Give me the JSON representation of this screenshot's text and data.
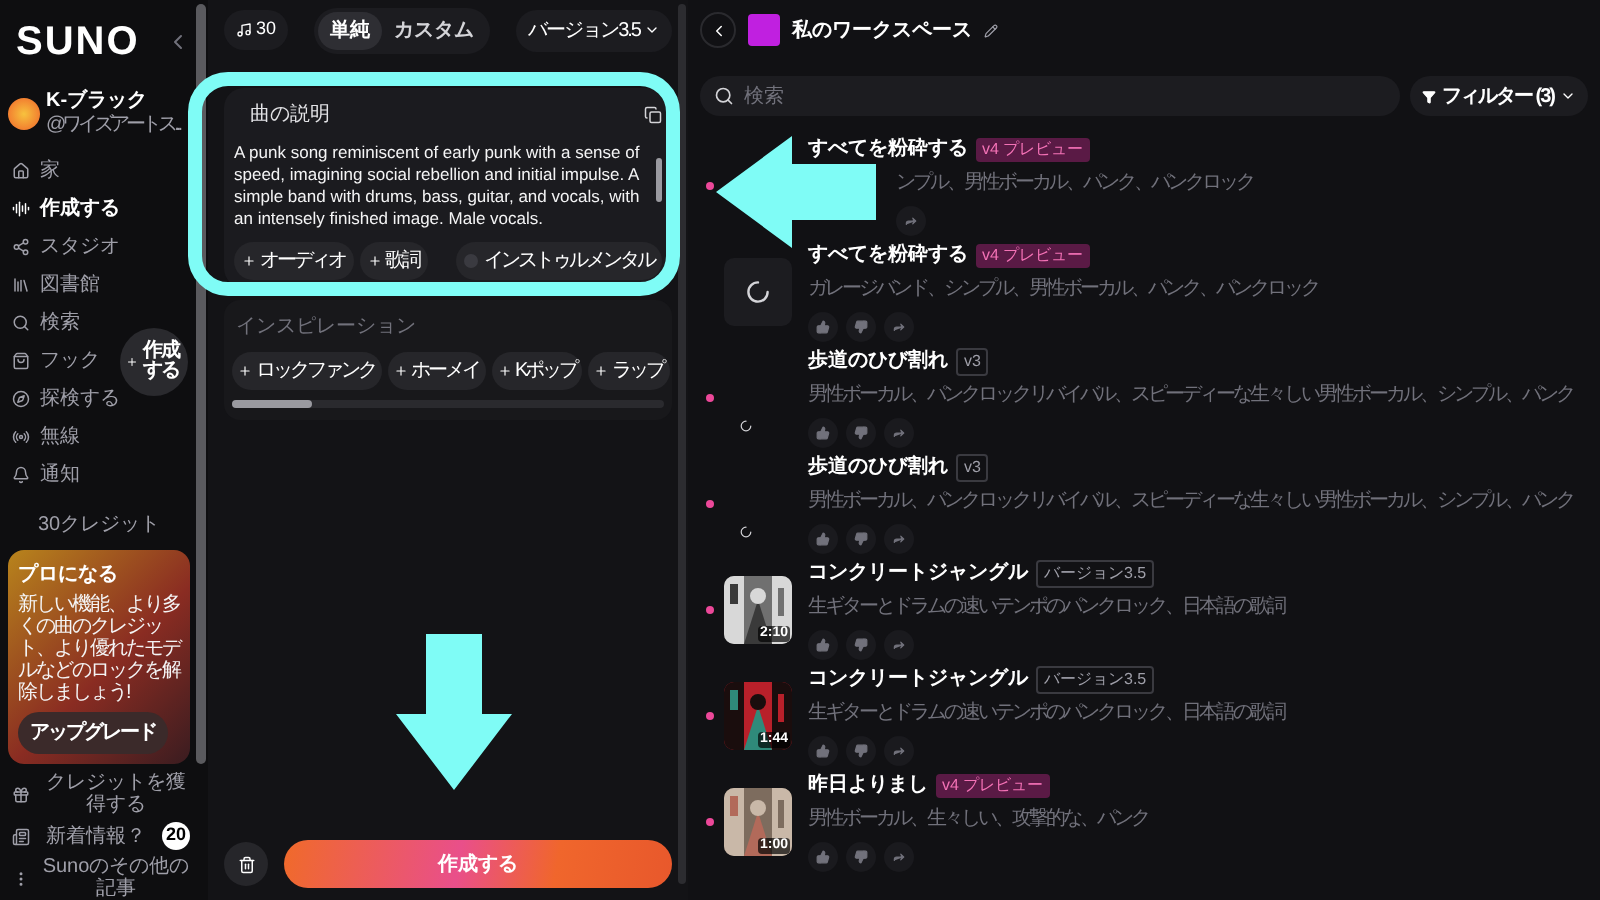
{
  "sidebar": {
    "logo": "SUNO",
    "user": {
      "name": "K-ブラック",
      "handle": "@ワイズアートス..."
    },
    "nav": [
      {
        "label": "家",
        "selected": false
      },
      {
        "label": "作成する",
        "selected": true
      },
      {
        "label": "スタジオ",
        "selected": false
      },
      {
        "label": "図書館",
        "selected": false
      },
      {
        "label": "検索",
        "selected": false
      },
      {
        "label": "フック",
        "selected": false
      },
      {
        "label": "探検する",
        "selected": false
      },
      {
        "label": "無線",
        "selected": false
      },
      {
        "label": "通知",
        "selected": false
      }
    ],
    "create_fab": "作成する",
    "credits": "30クレジット",
    "promo": {
      "title": "プロになる",
      "text": "新しい機能、より多くの曲のクレジット、より優れたモデルなどのロックを解除しましょう!",
      "button": "アップグレード"
    },
    "footer": [
      {
        "label": "クレジットを獲得する"
      },
      {
        "label": "新着情報？",
        "badge": "20"
      },
      {
        "label": "Sunoのその他の記事"
      }
    ]
  },
  "create_panel": {
    "credits": "30",
    "modes": [
      {
        "label": "単純",
        "selected": true
      },
      {
        "label": "カスタム",
        "selected": false
      }
    ],
    "version": "バージョン3.5",
    "description": {
      "title": "曲の説明",
      "value": "A punk song reminiscent of early punk with a sense of speed, imagining social rebellion and initial impulse. A simple band with drums, bass, guitar, and vocals, with an intensely finished image. Male vocals.",
      "buttons": [
        "オーディオ",
        "歌詞"
      ],
      "instrumental": {
        "label": "インストゥルメンタル",
        "on": false
      }
    },
    "inspiration": {
      "title": "インスピレーション",
      "chips": [
        "ロックファンク",
        "ホーメイ",
        "Kポップ",
        "ラップ"
      ]
    },
    "create_button": "作成する"
  },
  "workspace": {
    "title": "私のワークスペース",
    "search": {
      "placeholder": "検索"
    },
    "filter": "フィルター (3)",
    "tracks": [
      {
        "kind": "covered",
        "title": "すべてを粉砕する",
        "badge": {
          "label": "v4 プレビュー",
          "kind": "preview"
        },
        "tags": "ンプル、男性ボーカル、パンク、パンクロック",
        "new": true
      },
      {
        "kind": "loading",
        "title": "すべてを粉砕する",
        "badge": {
          "label": "v4 プレビュー",
          "kind": "preview"
        },
        "tags": "ガレージバンド、シンプル、男性ボーカル、パンク、パンクロック",
        "new": false
      },
      {
        "kind": "spinner",
        "title": "歩道のひび割れ",
        "badge": {
          "label": "v3",
          "kind": "version"
        },
        "tags": "男性ボーカル、パンクロックリバイバル、スピーディーな生々しい男性ボーカル、シンプル、パンク",
        "new": true
      },
      {
        "kind": "spinner",
        "title": "歩道のひび割れ",
        "badge": {
          "label": "v3",
          "kind": "version"
        },
        "tags": "男性ボーカル、パンクロックリバイバル、スピーディーな生々しい男性ボーカル、シンプル、パンク",
        "new": true
      },
      {
        "kind": "picture",
        "title": "コンクリートジャングル",
        "badge": {
          "label": "バージョン3.5",
          "kind": "version"
        },
        "tags": "生ギターとドラムの速いテンポのパンクロック、日本語の歌詞",
        "duration": "2:10",
        "new": true
      },
      {
        "kind": "picture",
        "title": "コンクリートジャングル",
        "badge": {
          "label": "バージョン3.5",
          "kind": "version"
        },
        "tags": "生ギターとドラムの速いテンポのパンクロック、日本語の歌詞",
        "duration": "1:44",
        "new": true
      },
      {
        "kind": "picture",
        "title": "昨日よりまし",
        "badge": {
          "label": "v4 プレビュー",
          "kind": "preview"
        },
        "tags": "男性ボーカル、生々しい、攻撃的な、パンク",
        "duration": "1:00",
        "new": true
      }
    ]
  }
}
